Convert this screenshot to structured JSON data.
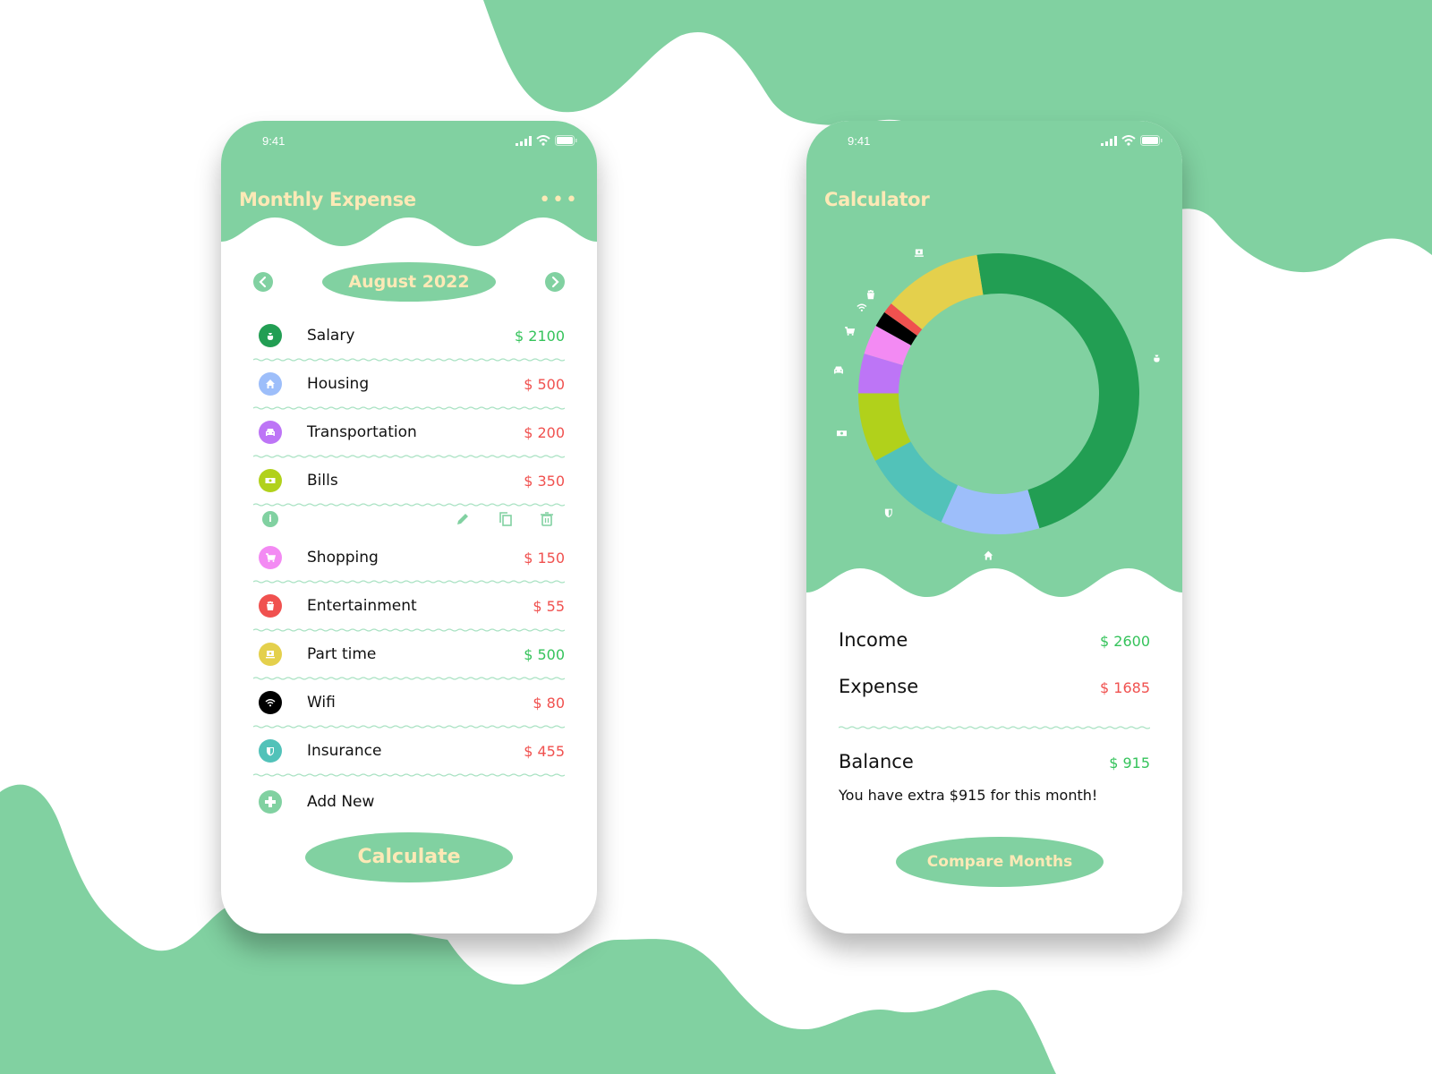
{
  "colors": {
    "accent": "#81d1a1",
    "title_text": "#fde9b6",
    "income": "#35c35b",
    "expense": "#f0514f"
  },
  "left_screen": {
    "status_time": "9:41",
    "title": "Monthly Expense",
    "more_icon": "more-horizontal-icon",
    "month": "August 2022",
    "prev_icon": "chevron-left-icon",
    "next_icon": "chevron-right-icon",
    "items": [
      {
        "name": "Salary",
        "amount": "$ 2100",
        "type": "income",
        "icon": "money-bag-icon",
        "color": "#229e53"
      },
      {
        "name": "Housing",
        "amount": "$ 500",
        "type": "expense",
        "icon": "home-icon",
        "color": "#9dbefa"
      },
      {
        "name": "Transportation",
        "amount": "$ 200",
        "type": "expense",
        "icon": "car-icon",
        "color": "#bd75f6"
      },
      {
        "name": "Bills",
        "amount": "$ 350",
        "type": "expense",
        "icon": "cash-icon",
        "color": "#b1d11b"
      },
      {
        "name": "Shopping",
        "amount": "$ 150",
        "type": "expense",
        "icon": "cart-icon",
        "color": "#f38af3"
      },
      {
        "name": "Entertainment",
        "amount": "$ 55",
        "type": "expense",
        "icon": "popcorn-icon",
        "color": "#f0514f"
      },
      {
        "name": "Part time",
        "amount": "$ 500",
        "type": "income",
        "icon": "laptop-icon",
        "color": "#e4d04c"
      },
      {
        "name": "Wifi",
        "amount": "$ 80",
        "type": "expense",
        "icon": "wifi-icon",
        "color": "#000000"
      },
      {
        "name": "Insurance",
        "amount": "$ 455",
        "type": "expense",
        "icon": "shield-icon",
        "color": "#52c2b9"
      }
    ],
    "row_actions": [
      "info-icon",
      "edit-icon",
      "copy-icon",
      "delete-icon"
    ],
    "add_new_label": "Add New",
    "calculate_label": "Calculate"
  },
  "right_screen": {
    "status_time": "9:41",
    "title": "Calculator",
    "summary": {
      "income_label": "Income",
      "income_value": "$ 2600",
      "expense_label": "Expense",
      "expense_value": "$ 1685",
      "balance_label": "Balance",
      "balance_value": "$ 915"
    },
    "message": "You have extra $915 for this month!",
    "compare_label": "Compare Months"
  },
  "chart_data": {
    "type": "pie",
    "variant": "donut",
    "title": "",
    "categories": [
      "Salary",
      "Housing",
      "Insurance",
      "Bills",
      "Transportation",
      "Shopping",
      "Wifi",
      "Entertainment",
      "Part time"
    ],
    "values": [
      2100,
      500,
      455,
      350,
      200,
      150,
      80,
      55,
      500
    ],
    "colors": [
      "#229e53",
      "#9dbefa",
      "#52c2b9",
      "#b1d11b",
      "#bd75f6",
      "#f38af3",
      "#000000",
      "#f0514f",
      "#e4d04c"
    ],
    "icons": [
      "money-bag-icon",
      "home-icon",
      "shield-icon",
      "cash-icon",
      "car-icon",
      "cart-icon",
      "wifi-icon",
      "popcorn-icon",
      "laptop-icon"
    ],
    "legend": "icons around ring"
  }
}
